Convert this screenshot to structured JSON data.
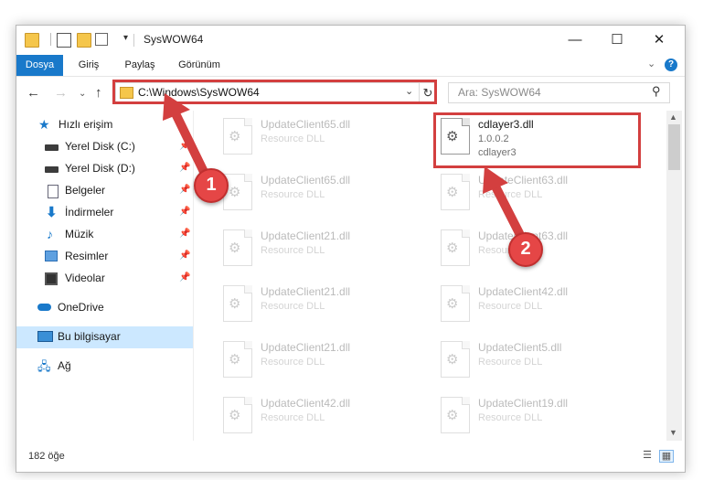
{
  "window": {
    "title": "SysWOW64",
    "controls": {
      "minimize": "—",
      "maximize": "☐",
      "close": "✕"
    },
    "qat_dropdown": "▾"
  },
  "ribbon": {
    "tabs": [
      "Dosya",
      "Giriş",
      "Paylaş",
      "Görünüm"
    ],
    "collapse": "⌄",
    "help": "?"
  },
  "nav": {
    "back": "←",
    "forward": "→",
    "recent": "⌄",
    "up": "↑",
    "address": "C:\\Windows\\SysWOW64",
    "address_dropdown": "⌄",
    "refresh": "↻",
    "search_placeholder": "Ara: SysWOW64",
    "search_icon": "⚲"
  },
  "sidebar": {
    "items": [
      {
        "label": "Hızlı erişim",
        "icon": "star-icon",
        "glyph": "★",
        "pinned": false
      },
      {
        "label": "Yerel Disk (C:)",
        "icon": "drive-icon",
        "pinned": true
      },
      {
        "label": "Yerel Disk (D:)",
        "icon": "drive-icon",
        "pinned": true
      },
      {
        "label": "Belgeler",
        "icon": "document-icon",
        "pinned": true
      },
      {
        "label": "İndirmeler",
        "icon": "download-icon",
        "glyph": "⬇",
        "pinned": true
      },
      {
        "label": "Müzik",
        "icon": "music-icon",
        "glyph": "♪",
        "pinned": true
      },
      {
        "label": "Resimler",
        "icon": "pictures-icon",
        "pinned": true
      },
      {
        "label": "Videolar",
        "icon": "video-icon",
        "pinned": true
      },
      {
        "label": "OneDrive",
        "icon": "cloud-icon",
        "pinned": false
      },
      {
        "label": "Bu bilgisayar",
        "icon": "computer-icon",
        "pinned": false,
        "selected": true
      },
      {
        "label": "Ağ",
        "icon": "network-icon",
        "glyph": "🖧",
        "pinned": false
      }
    ],
    "pin_glyph": "📌"
  },
  "files": {
    "left": [
      {
        "name": "UpdateClient65.dll",
        "type": "Resource DLL"
      },
      {
        "name": "UpdateClient65.dll",
        "type": "Resource DLL"
      },
      {
        "name": "UpdateClient21.dll",
        "type": "Resource DLL"
      },
      {
        "name": "UpdateClient21.dll",
        "type": "Resource DLL"
      },
      {
        "name": "UpdateClient21.dll",
        "type": "Resource DLL"
      },
      {
        "name": "UpdateClient42.dll",
        "type": "Resource DLL"
      }
    ],
    "right": [
      {
        "name": "cdlayer3.dll",
        "version": "1.0.0.2",
        "description": "cdlayer3",
        "highlighted": true
      },
      {
        "name": "UpdateClient63.dll",
        "type": "Resource DLL"
      },
      {
        "name": "UpdateClient63.dll",
        "type": "Resource DLL"
      },
      {
        "name": "UpdateClient42.dll",
        "type": "Resource DLL"
      },
      {
        "name": "UpdateClient5.dll",
        "type": "Resource DLL"
      },
      {
        "name": "UpdateClient19.dll",
        "type": "Resource DLL"
      }
    ],
    "gear_glyph": "⚙"
  },
  "scrollbar": {
    "up": "▲",
    "down": "▼"
  },
  "status": {
    "count": "182 öğe",
    "view_details": "☰",
    "view_tiles": "▦"
  },
  "annotations": {
    "badge1": "1",
    "badge2": "2",
    "color": "#d33f3f"
  }
}
